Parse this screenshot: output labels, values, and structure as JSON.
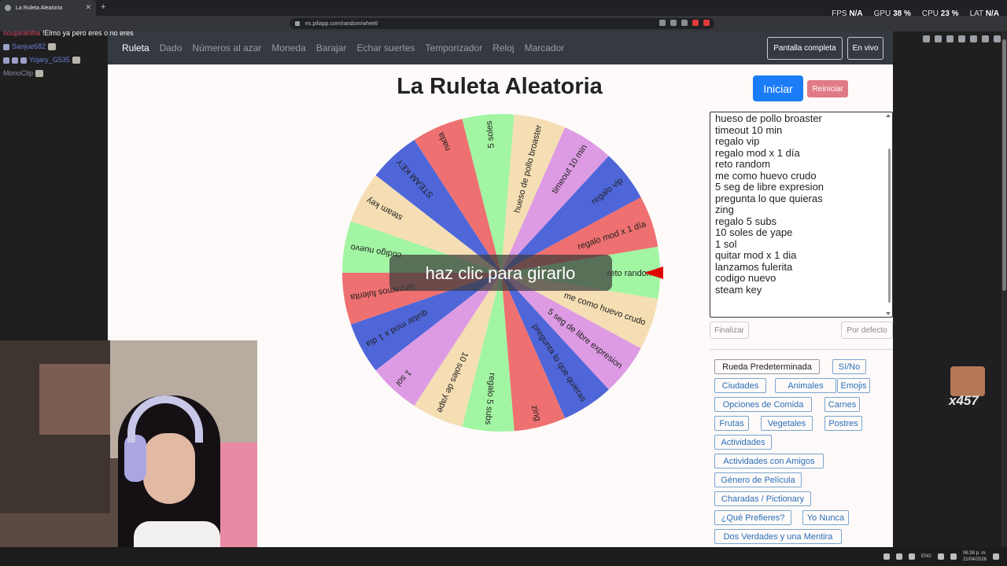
{
  "browser": {
    "tab_title": "La Ruleta Aleatoria",
    "url": "es.piliapp.com/random/wheel/"
  },
  "stats": {
    "fps_label": "FPS",
    "fps_value": "N/A",
    "gpu_label": "GPU",
    "gpu_value": "38 %",
    "cpu_label": "CPU",
    "cpu_value": "23 %",
    "lat_label": "LAT",
    "lat_value": "N/A"
  },
  "nav": {
    "links": [
      "Ruleta",
      "Dado",
      "Números al azar",
      "Moneda",
      "Barajar",
      "Echar suertes",
      "Temporizador",
      "Reloj",
      "Marcador"
    ],
    "fullscreen_label": "Pantalla completa",
    "live_label": "En vivo"
  },
  "page": {
    "title": "La Ruleta Aleatoria",
    "start_label": "Iniciar",
    "reset_label": "Reiniciar",
    "spin_hint": "haz clic para girarlo",
    "finish_label": "Finalizar",
    "default_label": "Por defecto"
  },
  "wheel": {
    "colors": {
      "red": "#ee7070",
      "green": "#a2f5a2",
      "tan": "#f5deb3",
      "pink": "#dd9be3",
      "blue": "#4f66d9",
      "pointer": "#e00000"
    },
    "segments": [
      {
        "label": "reto random",
        "color": "green"
      },
      {
        "label": "me como huevo crudo",
        "color": "tan"
      },
      {
        "label": "5 seg de libre expresion",
        "color": "pink"
      },
      {
        "label": "pregunta lo que quieras",
        "color": "blue"
      },
      {
        "label": "zing",
        "color": "red"
      },
      {
        "label": "regalo 5 subs",
        "color": "green"
      },
      {
        "label": "10 soles de yape",
        "color": "tan"
      },
      {
        "label": "1 sol",
        "color": "pink"
      },
      {
        "label": "quitar mod x 1 dia",
        "color": "blue"
      },
      {
        "label": "lanzamos fulerita",
        "color": "red"
      },
      {
        "label": "codigo nuevo",
        "color": "green"
      },
      {
        "label": "steam key",
        "color": "tan"
      },
      {
        "label": "STEAM KEY",
        "color": "blue"
      },
      {
        "label": "nada",
        "color": "red"
      },
      {
        "label": "5 soles",
        "color": "green"
      },
      {
        "label": "hueso de pollo broaster",
        "color": "tan"
      },
      {
        "label": "timeout 10 min",
        "color": "pink"
      },
      {
        "label": "regalo vip",
        "color": "blue"
      },
      {
        "label": "regalo mod x 1 día",
        "color": "red"
      }
    ]
  },
  "options_list": [
    "hueso de pollo broaster",
    "timeout 10 min",
    "regalo vip",
    "regalo mod x 1 día",
    "reto random",
    "me como huevo crudo",
    "5 seg de libre expresion",
    "pregunta lo que quieras",
    "zing",
    "regalo 5 subs",
    "10 soles de yape",
    "1 sol",
    "quitar mod x 1 dia",
    "lanzamos fulerita",
    "codigo nuevo",
    "steam key"
  ],
  "presets": [
    "Rueda Predeterminada",
    "Sí/No",
    "Ciudades",
    "Animales",
    "Emojis",
    "Opciones de Comida",
    "Carnes",
    "Frutas",
    "Vegetales",
    "Postres",
    "Actividades",
    "Actividades con Amigos",
    "Género de Película",
    "Charadas / Pictionary",
    "¿Qué Prefieres?",
    "Yo Nunca",
    "Dos Verdades y una Mentira"
  ],
  "chat": [
    {
      "name": "ooupirahiha",
      "msg": "!Elmo ya pero eres o no eres"
    },
    {
      "name": "Sanjue682",
      "msg": ""
    },
    {
      "name": "Yojary_G535",
      "msg": ""
    },
    {
      "name": "MonoClip",
      "msg": ""
    }
  ],
  "emote_counter": "x457",
  "taskbar": {
    "lang": "ENG",
    "time": "06:38 p. m.",
    "date": "21/04/2026"
  }
}
